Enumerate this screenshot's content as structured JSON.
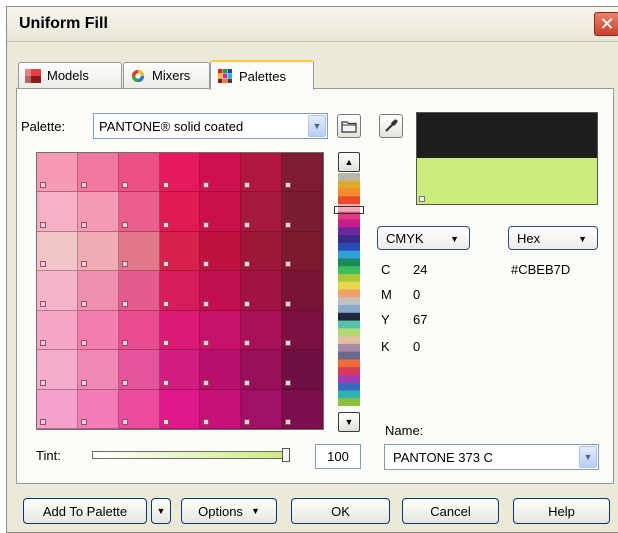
{
  "window": {
    "title": "Uniform Fill",
    "close_glyph": "✕"
  },
  "tabs": [
    {
      "label": "Models",
      "icon": "models-icon"
    },
    {
      "label": "Mixers",
      "icon": "mixers-icon"
    },
    {
      "label": "Palettes",
      "icon": "palettes-icon",
      "active": true
    }
  ],
  "palette": {
    "label": "Palette:",
    "selected": "PANTONE® solid coated",
    "grid_colors": [
      [
        "#f599b4",
        "#f0789f",
        "#ec4f86",
        "#e6195c",
        "#cf0f4f",
        "#b0163f",
        "#7d1c33"
      ],
      [
        "#f6b0c5",
        "#f39ab5",
        "#ea5f8c",
        "#df1a55",
        "#c8104b",
        "#a61a3f",
        "#7c1b34"
      ],
      [
        "#f0c5c8",
        "#eeaeb4",
        "#e1788a",
        "#d6214a",
        "#be1340",
        "#9e1739",
        "#7c1b30"
      ],
      [
        "#f4b5cc",
        "#ee8fb0",
        "#e45a8f",
        "#d61c5d",
        "#c10f52",
        "#a01345",
        "#781535"
      ],
      [
        "#f8a6c6",
        "#f47fae",
        "#ea4c91",
        "#dd1978",
        "#c8116a",
        "#a81058",
        "#7c0f42"
      ],
      [
        "#f3aecb",
        "#ee88b4",
        "#e4549e",
        "#d21d83",
        "#b9106d",
        "#98105b",
        "#6e0f41"
      ],
      [
        "#f6a0cc",
        "#f27cb8",
        "#eb4a9e",
        "#e1188b",
        "#c7107a",
        "#a01066",
        "#7a0e4e"
      ]
    ],
    "strip_colors": [
      "#b8b8a8",
      "#e0a82e",
      "#f58a2a",
      "#e84a2a",
      "#f2a8b8",
      "#e03a80",
      "#c41e8c",
      "#6a2a9a",
      "#3a2a8a",
      "#2a4ab8",
      "#30a0d8",
      "#1a8a5a",
      "#3cbe5a",
      "#a8c83a",
      "#e8d84a",
      "#f0a06a",
      "#c0c0c0",
      "#8aa8c8",
      "#1a2a3a",
      "#58c0a8",
      "#b0d870",
      "#e0c0a0",
      "#a88aa8",
      "#6a6a8a",
      "#f06a3a",
      "#d83a5a",
      "#a83ab0",
      "#3a6ac0",
      "#30b0b0",
      "#8ac03a"
    ]
  },
  "color_model": {
    "model": "CMYK",
    "format": "Hex",
    "values": [
      {
        "label": "C",
        "value": "24"
      },
      {
        "label": "M",
        "value": "0"
      },
      {
        "label": "Y",
        "value": "67"
      },
      {
        "label": "K",
        "value": "0"
      }
    ],
    "hex": "#CBEB7D",
    "old_color": "#1e1e1e",
    "new_color": "#cbeb7d"
  },
  "tint": {
    "label": "Tint:",
    "value": "100"
  },
  "name": {
    "label": "Name:",
    "value": "PANTONE 373 C"
  },
  "buttons": {
    "add_to_palette": "Add To Palette",
    "options": "Options",
    "ok": "OK",
    "cancel": "Cancel",
    "help": "Help"
  }
}
